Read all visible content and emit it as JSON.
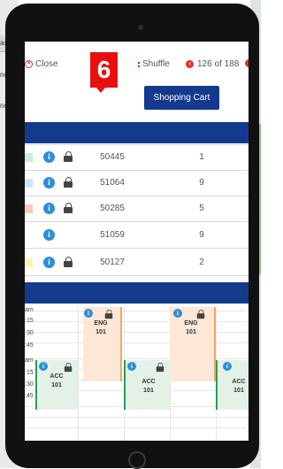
{
  "background": {
    "left_text": [
      "as",
      "nor",
      "nor"
    ]
  },
  "toolbar": {
    "close_label": "Close",
    "shuffle_label": "Shuffle",
    "counter": "126 of 188",
    "cart_label": "Shopping Cart",
    "step_badge": "6"
  },
  "rows": [
    {
      "code": "50445",
      "num": "1",
      "swatch": "#c9ecd8",
      "locked": true
    },
    {
      "code": "51064",
      "num": "9",
      "swatch": "#cfe3f7",
      "locked": true
    },
    {
      "code": "50285",
      "num": "5",
      "swatch": "#f8c9c0",
      "locked": true
    },
    {
      "code": "51059",
      "num": "9",
      "swatch": "",
      "locked": false
    },
    {
      "code": "50127",
      "num": "2",
      "swatch": "#fbf3b8",
      "locked": true
    }
  ],
  "schedule": {
    "times": [
      "am",
      ":15",
      ":30",
      ":45",
      "am",
      ":15",
      ":30",
      ":45"
    ],
    "blocks": [
      {
        "name": "ENG",
        "num": "101"
      },
      {
        "name": "ENG",
        "num": "101"
      },
      {
        "name": "ACC",
        "num": "101"
      },
      {
        "name": "ACC",
        "num": "101"
      },
      {
        "name": "ACC",
        "num": "101"
      }
    ]
  },
  "colors": {
    "brand_blue": "#133a8c",
    "accent_red": "#e8100f",
    "info_blue": "#2d8fd6"
  }
}
